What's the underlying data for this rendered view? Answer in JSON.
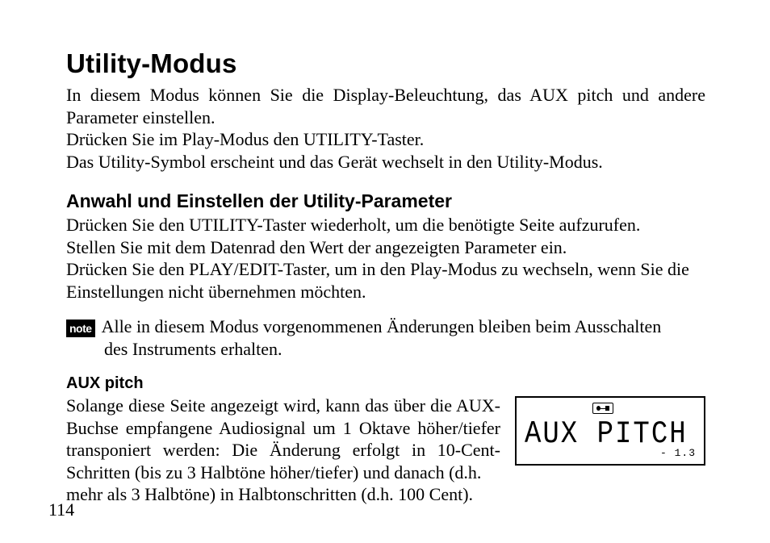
{
  "title": "Utility-Modus",
  "intro": {
    "p1": "In diesem Modus können Sie die Display-Beleuchtung, das AUX pitch und andere Parameter einstellen.",
    "p2": "Drücken Sie im Play-Modus den UTILITY-Taster.",
    "p3": "Das Utility-Symbol erscheint und das Gerät wechselt in den Utility-Modus."
  },
  "subhead": "Anwahl und Einstellen der Utility-Parameter",
  "body": {
    "p1": "Drücken Sie den UTILITY-Taster wiederholt, um die benötigte Seite aufzurufen.",
    "p2": "Stellen Sie mit dem Datenrad den Wert der angezeigten Parameter ein.",
    "p3": "Drücken Sie den PLAY/EDIT-Taster, um in den Play-Modus zu wechseln, wenn Sie die Einstellungen nicht übernehmen möchten."
  },
  "note": {
    "badge": "note",
    "line1": "Alle in diesem Modus vorgenommenen Änderungen bleiben beim Ausschalten",
    "line2": "des Instruments erhalten."
  },
  "param": {
    "head": "AUX pitch",
    "text_col": "Solange diese Seite angezeigt wird, kann das über die AUX-Buchse empfangene Audiosignal um 1 Oktave höher/tiefer transponiert werden: Die Änderung erfolgt in 10-Cent-Schritten (bis zu 3 Halbtöne höher/tiefer) und danach (d.h.",
    "text_full": "mehr als 3 Halbtöne) in Halbtonschritten (d.h. 100 Cent)."
  },
  "lcd": {
    "main": "AUX PITCH",
    "sub": "- 1.3"
  },
  "page_number": "114"
}
